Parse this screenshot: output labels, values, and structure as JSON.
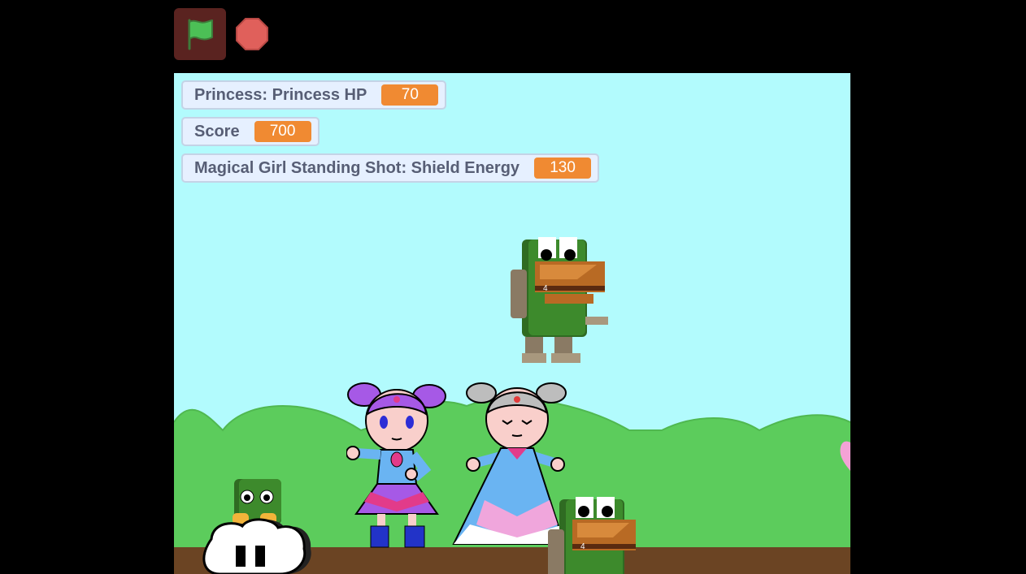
{
  "controls": {
    "green_flag_icon": "green-flag-icon",
    "stop_icon": "stop-sign-icon"
  },
  "monitors": [
    {
      "label": "Princess: Princess HP",
      "value": "70"
    },
    {
      "label": "Score",
      "value": "700"
    },
    {
      "label": "Magical Girl Standing Shot: Shield Energy",
      "value": "130"
    }
  ],
  "colors": {
    "stage_sky": "#b2fbfd",
    "hills": "#5ccc5c",
    "ground": "#6b4423",
    "monitor_value": "#f08a32",
    "flag_button_bg": "#5a2320",
    "stop_button": "#e0605b"
  },
  "sprites": [
    "magical-girl",
    "princess",
    "frog-robot-flying",
    "frog-robot-ground",
    "cloud-frog",
    "pink-heart"
  ]
}
